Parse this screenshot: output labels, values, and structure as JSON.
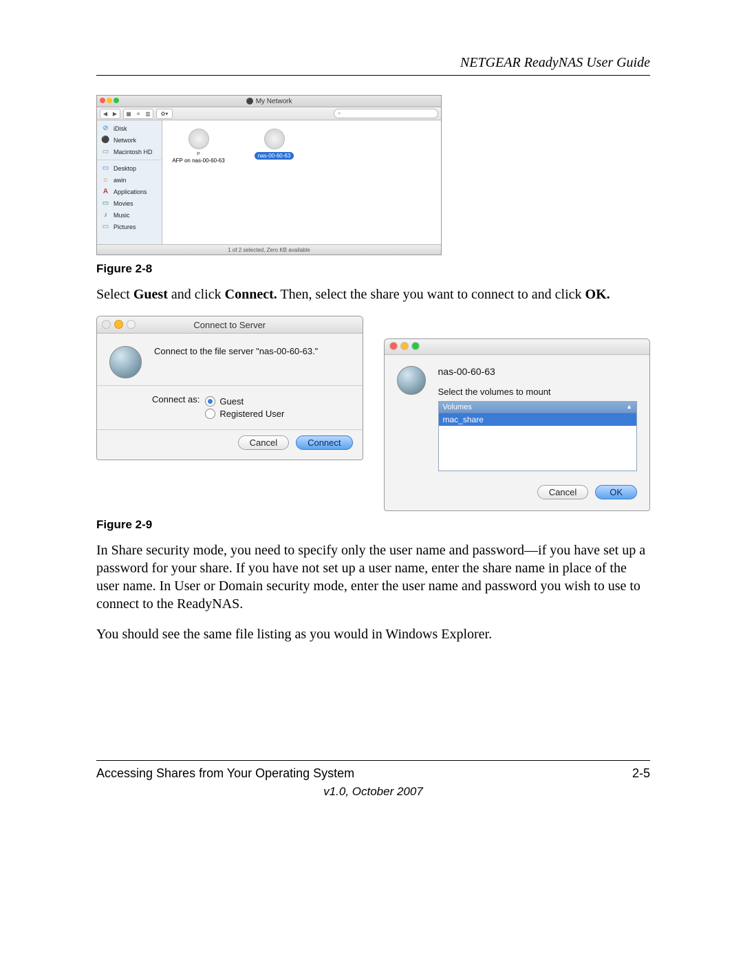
{
  "header": {
    "title": "NETGEAR ReadyNAS User Guide"
  },
  "fig28": {
    "caption": "Figure 2-8",
    "window_title": "My Network",
    "toolbar": {
      "back": "◀",
      "fwd": "▶",
      "view1": "▦",
      "view2": "≡",
      "view3": "▥",
      "gear": "✿▾",
      "search_icon": "⌕"
    },
    "sidebar": {
      "items": [
        {
          "icon": "⊘",
          "label": "iDisk"
        },
        {
          "icon": "⚫",
          "label": "Network"
        },
        {
          "icon": "▭",
          "label": "Macintosh HD"
        }
      ],
      "places": [
        {
          "icon": "▭",
          "label": "Desktop"
        },
        {
          "icon": "⌂",
          "label": "awin"
        },
        {
          "icon": "A",
          "label": "Applications"
        },
        {
          "icon": "▭",
          "label": "Movies"
        },
        {
          "icon": "♪",
          "label": "Music"
        },
        {
          "icon": "▭",
          "label": "Pictures"
        }
      ]
    },
    "content": {
      "items": [
        {
          "label": "AFP on nas-00-60-63",
          "selected": false,
          "sublabel": "P"
        },
        {
          "label": "nas-00-60-63",
          "selected": true
        }
      ]
    },
    "status": "1 of 2 selected, Zero KB available"
  },
  "para1": {
    "t1": "Select ",
    "b1": "Guest",
    "t2": " and click ",
    "b2": "Connect.",
    "t3": " Then, select the share you want to connect to and click ",
    "b3": "OK.",
    "t4": ""
  },
  "fig29": {
    "caption": "Figure 2-9",
    "connect": {
      "title": "Connect to Server",
      "prompt": "Connect to the file server \"nas-00-60-63.\"",
      "connect_as_label": "Connect as:",
      "guest_label": "Guest",
      "registered_label": "Registered User",
      "cancel": "Cancel",
      "connect_btn": "Connect"
    },
    "volumes": {
      "server_name": "nas-00-60-63",
      "prompt": "Select the volumes to mount",
      "col_header": "Volumes",
      "sort_icon": "▲",
      "items": [
        "mac_share"
      ],
      "cancel": "Cancel",
      "ok": "OK"
    }
  },
  "para2": "In Share security mode, you need to specify only the user name and password—if you have set up a password for your share. If you have not set up a user name, enter the share name in place of the user name. In User or Domain security mode, enter the user name and password you wish to use to connect to the ReadyNAS.",
  "para3": "You should see the same file listing as you would in Windows Explorer.",
  "footer": {
    "section": "Accessing Shares from Your Operating System",
    "page": "2-5",
    "version": "v1.0, October 2007"
  }
}
